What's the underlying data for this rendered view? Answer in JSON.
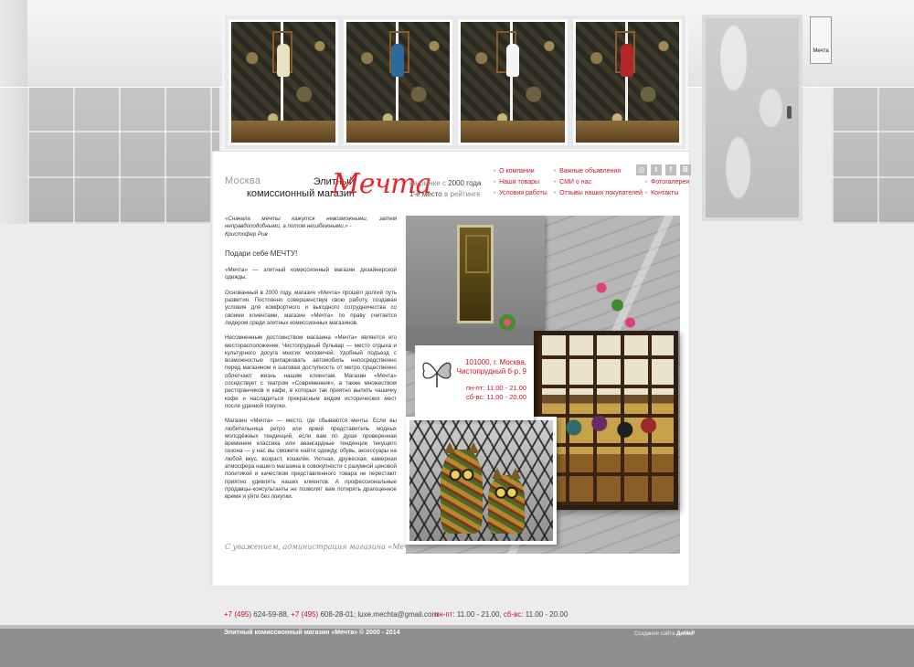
{
  "header": {
    "city": "Москва",
    "tagline_1": "Элитный",
    "tagline_2": "комиссионный магазин",
    "logo": "Мечта",
    "market_prefix": "на рынке с",
    "market_year": "2000 года",
    "rank_prefix": "1-е место",
    "rank_suffix": "в рейтинге"
  },
  "plaque": "Мечта",
  "nav": [
    {
      "label": "О компании"
    },
    {
      "label": "Важные объявления"
    },
    {
      "label": "Наши товары"
    },
    {
      "label": "СМИ о нас"
    },
    {
      "label": "Фотогалерея"
    },
    {
      "label": "Условия работы"
    },
    {
      "label": "Отзывы наших покупателей"
    },
    {
      "label": "Контакты"
    }
  ],
  "socials": [
    {
      "name": "instagram-icon",
      "glyph": "◎"
    },
    {
      "name": "twitter-icon",
      "glyph": "t"
    },
    {
      "name": "facebook-icon",
      "glyph": "f"
    },
    {
      "name": "vkontakte-icon",
      "glyph": "В"
    }
  ],
  "content": {
    "quote": "«Сначала мечты кажутся невозможными, затем неправдоподобными, а потом неизбежными.» -",
    "quote_author": "Кристофер Рив",
    "gift": "Подари себе МЕЧТУ!",
    "paragraphs": [
      "«Мечта» — элитный комиссионный магазин дизайнерской одежды.",
      "Основанный в 2000 году, магазин «Мечта» прошёл долгий путь развития. Постоянно совершенствуя свою работу, создавая условия для комфортного и выгодного сотрудничества со своими клиентами, магазин «Мечта» по праву считается лидером среди элитных комиссионных магазинов.",
      "Несомненным достоинством магазина «Мечта» является его месторасположение. Чистопрудный бульвар — место отдыха и культурного досуга многих москвичей. Удобный подъезд с возможностью припарковать автомобиль непосредственно перед магазином и шаговая доступность от метро существенно облегчают жизнь нашим клиентам. Магазин «Мечта» соседствует с театром «Современник», а также множеством ресторанчиков и кафе, в которых так приятно выпить чашечку кофе и насладиться прекрасным видом исторических мест после удачной покупки.",
      "Магазин «Мечта» — место, где сбываются мечты. Если вы любительница ретро или яркий представитель модных молодёжных тенденций, если вам по душе проверенная временем классика или авангардные тенденции текущего сезона — у нас вы сможете найти одежду, обувь, аксессуары на любой вкус, возраст, кошелёк. Уютная, дружеская, камерная атмосфера нашего магазина в совокупности с разумной ценовой политикой и качеством представленного товара не перестают приятно удивлять наших клиентов. А профессиональные продавцы-консультанты не позволят вам потерять драгоценное время и уйти без покупки."
    ],
    "signature": "С уважением, администрация магазина «Мечта»"
  },
  "address": {
    "line1": "101000, г. Москва,",
    "line2": "Чистопрудный б-р, 9",
    "hours1": "пн-пт: 11.00 - 21.00",
    "hours2": "сб-вс: 11.00 - 20.00"
  },
  "footer": {
    "phone1_code": "+7 (495)",
    "phone1_num": "624-59-88,",
    "phone2_code": "+7 (495)",
    "phone2_num": "608-28-01;",
    "email": "luxe.mechta@gmail.com",
    "hours_wd_label": "пн-пт:",
    "hours_wd": "11.00 - 21.00,",
    "hours_we_label": "сб-вс:",
    "hours_we": "11.00 - 20.00",
    "copyright": "Элитный комиссионный магазин «Мечта» © 2000 - 2014",
    "dev_prefix": "Создание сайта",
    "dev_name": "ДиМеР"
  },
  "colors": {
    "accent": "#c8102e",
    "logo": "#e8262a",
    "footer_bar": "#8f8f8f"
  }
}
